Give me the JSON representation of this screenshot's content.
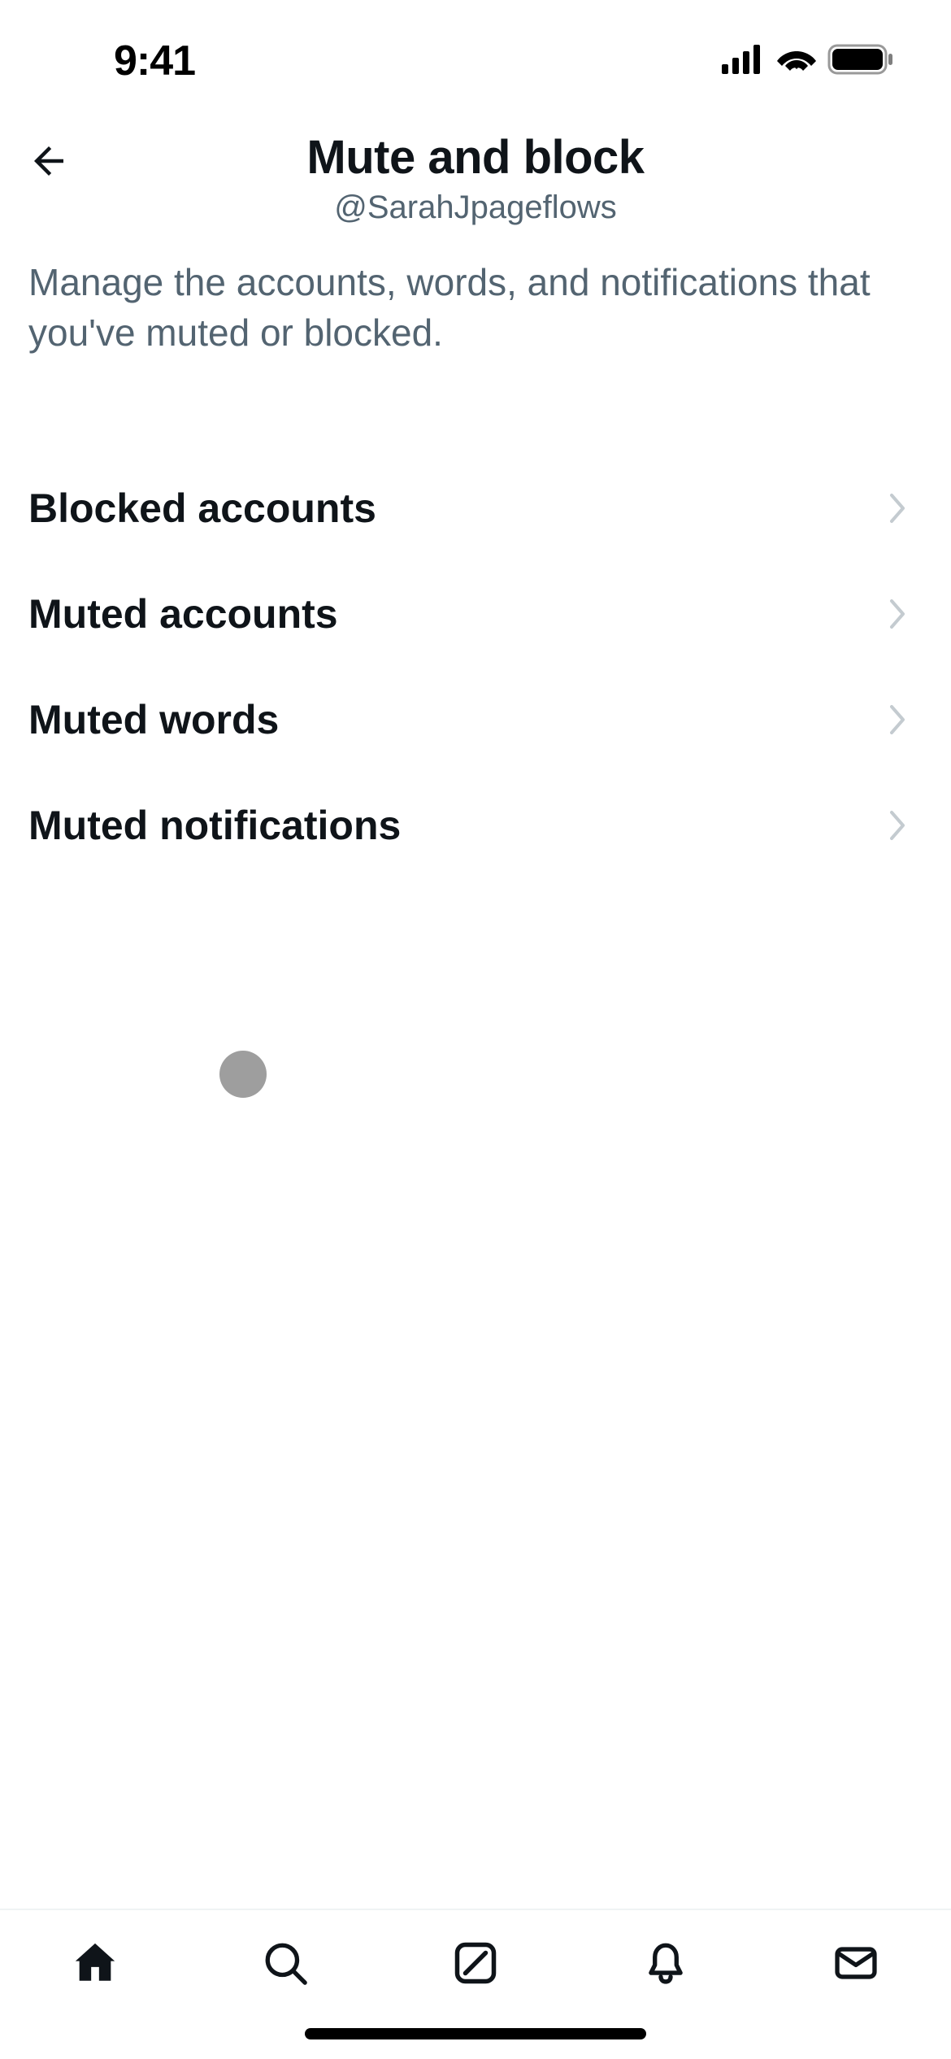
{
  "status_bar": {
    "time": "9:41"
  },
  "header": {
    "title": "Mute and block",
    "subtitle": "@SarahJpageflows"
  },
  "description": "Manage the accounts, words, and notifications that you've muted or blocked.",
  "settings": [
    {
      "label": "Blocked accounts"
    },
    {
      "label": "Muted accounts"
    },
    {
      "label": "Muted words"
    },
    {
      "label": "Muted notifications"
    }
  ],
  "nav": {
    "items": [
      "home",
      "search",
      "compose",
      "notifications",
      "messages"
    ]
  }
}
